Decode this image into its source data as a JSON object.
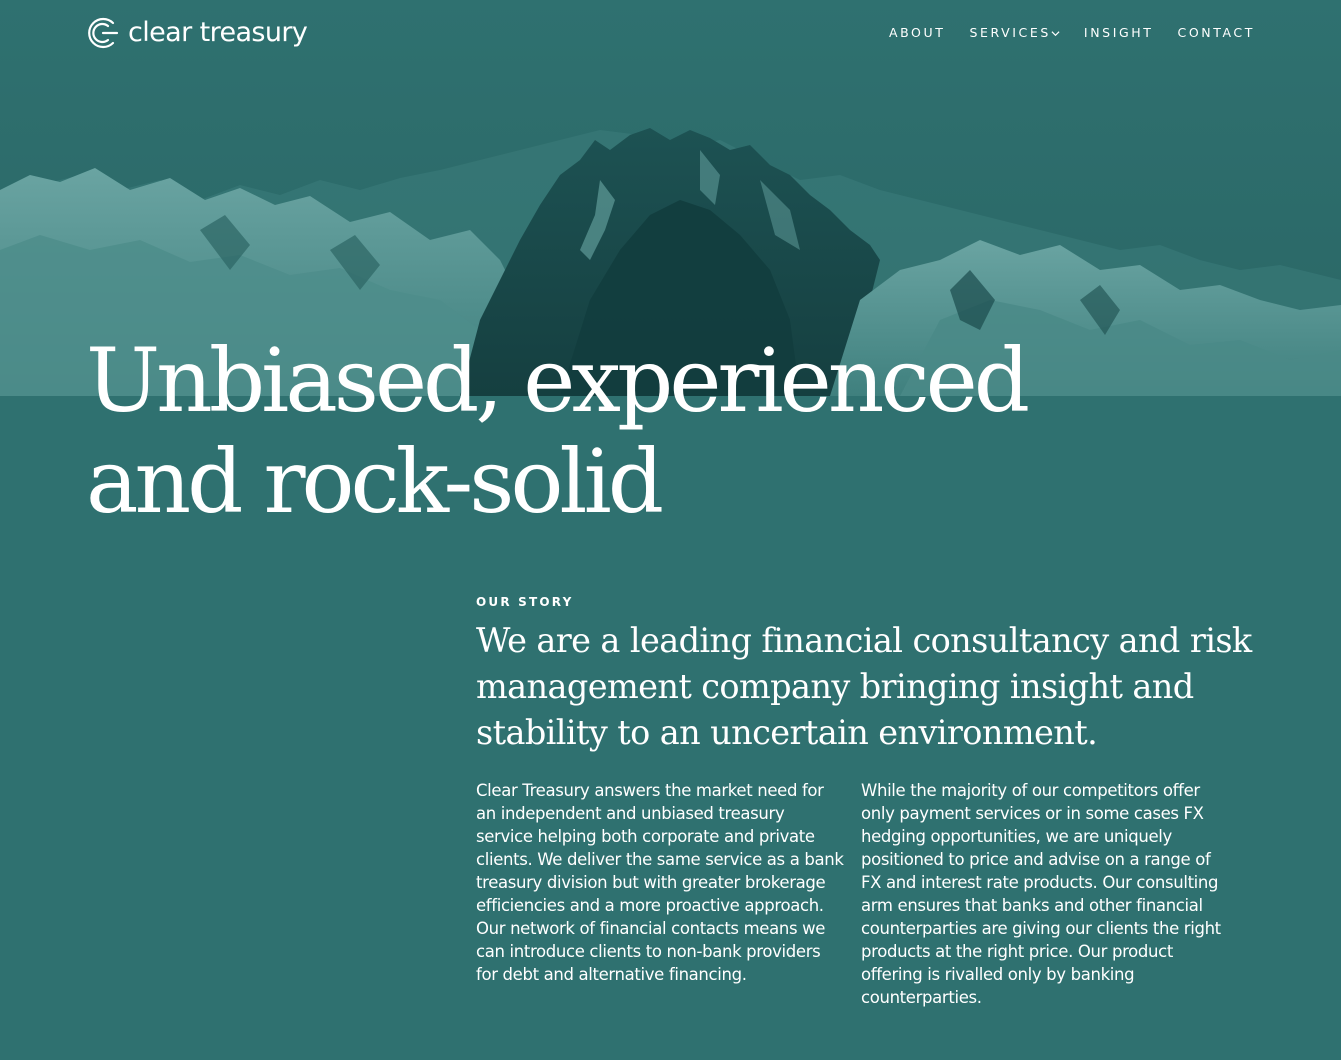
{
  "brand": {
    "name": "clear treasury"
  },
  "nav": {
    "items": [
      {
        "label": "ABOUT",
        "has_dropdown": false
      },
      {
        "label": "SERVICES",
        "has_dropdown": true
      },
      {
        "label": "INSIGHT",
        "has_dropdown": false
      },
      {
        "label": "CONTACT",
        "has_dropdown": false
      }
    ]
  },
  "hero": {
    "headline_line1": "Unbiased, experienced",
    "headline_line2": "and rock-solid"
  },
  "story": {
    "kicker": "OUR STORY",
    "lead": "We are a leading financial consultancy and risk management company bringing insight and stability to an uncertain environment.",
    "col_left": "Clear Treasury answers the market need for an independent and unbiased treasury service helping both corporate and private clients. We deliver the same service as a bank treasury division but with greater brokerage efficiencies and a more proactive approach. Our network of financial contacts means we can introduce clients to non-bank providers for debt and alternative financing.",
    "col_right": "While the majority of our competitors offer only payment services or in some cases FX hedging opportunities, we are uniquely positioned to price and advise on a range of FX and interest rate products. Our consulting arm ensures that banks and other financial counterparties are giving our clients the right products at the right price. Our product offering is rivalled only by banking counterparties."
  },
  "colors": {
    "background": "#2f7170",
    "text": "#ffffff",
    "mountain_dark": "#123d3e",
    "mountain_light": "#5f9b99"
  },
  "icons": {
    "logo": "clear-treasury-logo-icon",
    "dropdown": "chevron-down-icon"
  }
}
